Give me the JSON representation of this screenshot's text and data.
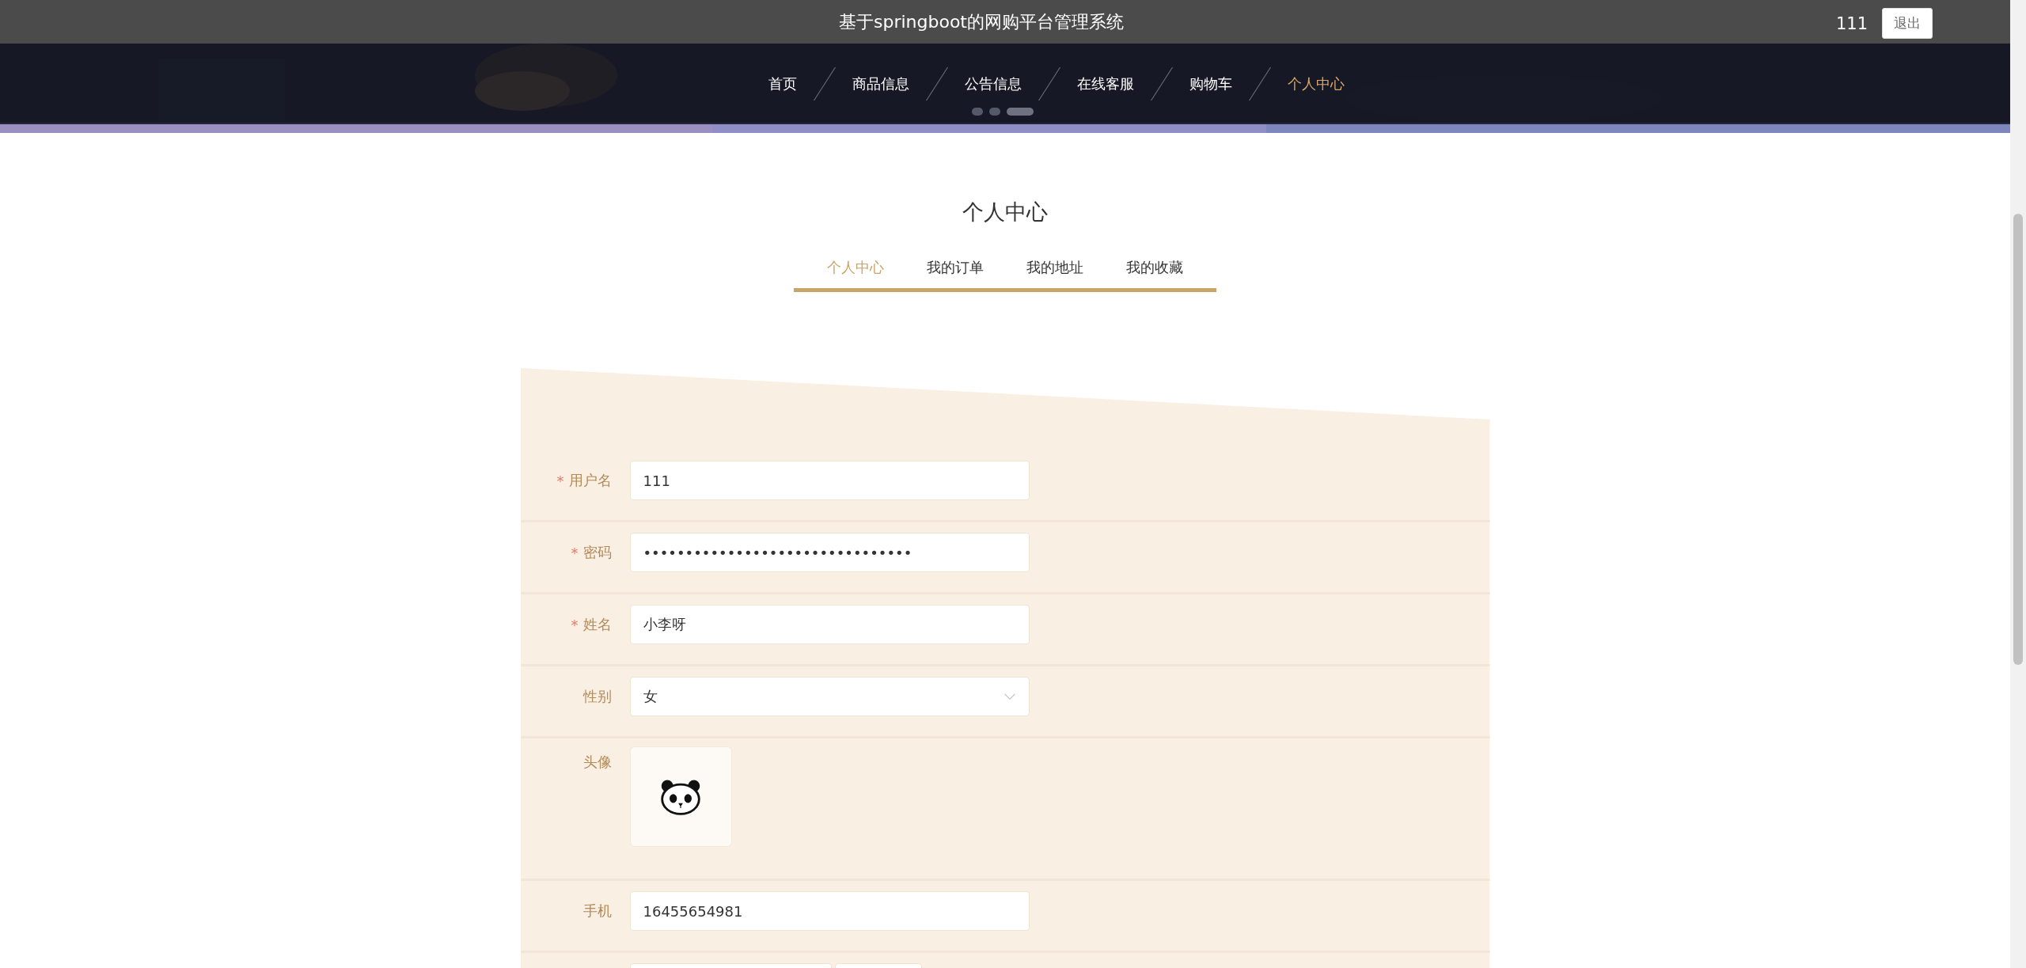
{
  "header": {
    "title": "基于springboot的网购平台管理系统",
    "user": "111",
    "logout": "退出"
  },
  "nav": [
    {
      "label": "首页",
      "selected": false
    },
    {
      "label": "商品信息",
      "selected": false
    },
    {
      "label": "公告信息",
      "selected": false
    },
    {
      "label": "在线客服",
      "selected": false
    },
    {
      "label": "购物车",
      "selected": false
    },
    {
      "label": "个人中心",
      "selected": true
    }
  ],
  "banner": {
    "kind": "picture",
    "slides": [
      {
        "selected": false
      },
      {
        "selected": false
      },
      {
        "selected": true
      }
    ]
  },
  "page_title": "个人中心",
  "tabs": [
    {
      "label": "个人中心",
      "selected": true
    },
    {
      "label": "我的订单",
      "selected": false
    },
    {
      "label": "我的地址",
      "selected": false
    },
    {
      "label": "我的收藏",
      "selected": false
    }
  ],
  "form": {
    "fields": [
      {
        "kind": "text",
        "required_mark": "*",
        "label": "用户名",
        "value": "111"
      },
      {
        "kind": "text",
        "required_mark": "*",
        "label": "密码",
        "value": "••••••••••••••••••••••••••••••••"
      },
      {
        "kind": "text",
        "required_mark": "*",
        "label": "姓名",
        "value": "小李呀"
      },
      {
        "kind": "select",
        "label": "性别",
        "value": "女"
      },
      {
        "label": "头像"
      },
      {
        "kind": "text",
        "label": "手机",
        "value": "16455654981"
      },
      {
        "kind": "pair"
      }
    ]
  }
}
